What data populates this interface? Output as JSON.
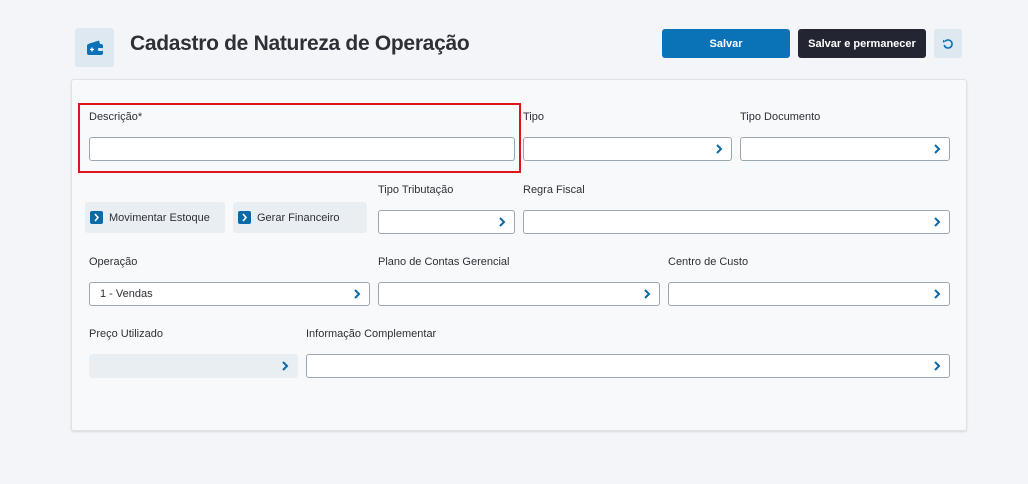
{
  "header": {
    "title": "Cadastro de Natureza de Operação",
    "icon": "wallet-add-icon",
    "save_label": "Salvar",
    "save_stay_label": "Salvar e permanecer",
    "back_icon": "undo-icon"
  },
  "colors": {
    "primary": "#0a73b7",
    "dark": "#232532",
    "highlight": "#e0151b"
  },
  "form": {
    "descricao": {
      "label": "Descrição*",
      "value": ""
    },
    "tipo": {
      "label": "Tipo",
      "value": ""
    },
    "tipo_documento": {
      "label": "Tipo Documento",
      "value": ""
    },
    "movimentar_estoque": {
      "label": "Movimentar Estoque"
    },
    "gerar_financeiro": {
      "label": "Gerar Financeiro"
    },
    "tipo_tributacao": {
      "label": "Tipo Tributação",
      "value": ""
    },
    "regra_fiscal": {
      "label": "Regra Fiscal",
      "value": ""
    },
    "operacao": {
      "label": "Operação",
      "value": "1 - Vendas"
    },
    "plano_contas": {
      "label": "Plano de Contas Gerencial",
      "value": ""
    },
    "centro_custo": {
      "label": "Centro de Custo",
      "value": ""
    },
    "preco_utilizado": {
      "label": "Preço Utilizado",
      "value": ""
    },
    "info_complementar": {
      "label": "Informação Complementar",
      "value": ""
    }
  }
}
